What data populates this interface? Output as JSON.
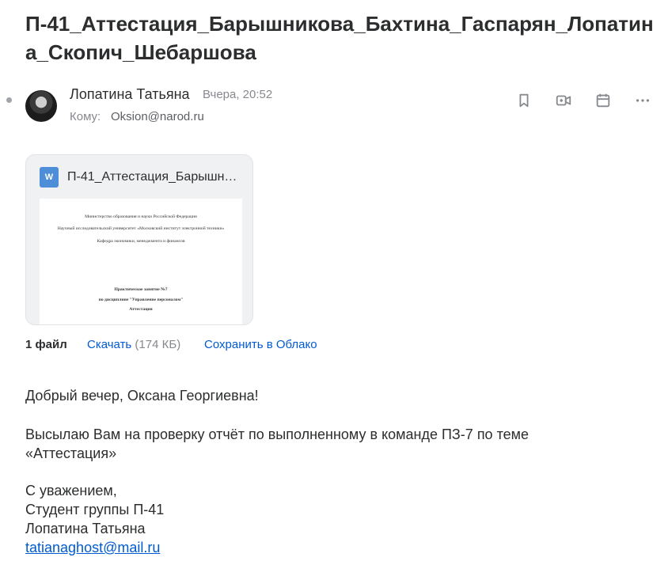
{
  "message": {
    "subject": "П-41_Аттестация_Барышникова_Бахтина_Гаспарян_Лопатина_Скопич_Шебаршова",
    "sender": {
      "name": "Лопатина Татьяна",
      "time": "Вчера, 20:52"
    },
    "recipient": {
      "label": "Кому:",
      "address": "Oksion@narod.ru"
    }
  },
  "header_actions": [
    "bookmark-icon",
    "video-call-icon",
    "calendar-icon",
    "more-icon"
  ],
  "attachment": {
    "file_name": "П-41_Аттестация_Барышн…",
    "icon_letter": "W",
    "preview_lines": [
      "Министерство образования и науки Российской Федерации",
      "Научный исследовательский университет «Московский институт электронной техники»",
      "Кафедра экономики, менеджмента и финансов",
      "Практическое занятие №7",
      "по дисциплине \"Управление персоналом\"",
      "Аттестация"
    ]
  },
  "files": {
    "count": "1 файл",
    "download_label": "Скачать",
    "size": "(174 КБ)",
    "cloud_label": "Сохранить в Облако"
  },
  "body": {
    "greeting": "Добрый вечер, Оксана Георгиевна!",
    "para_line1": "Высылаю Вам на проверку отчёт по выполненному в команде ПЗ-7 по теме",
    "para_line2": "«Аттестация»",
    "signoff": "С уважением,",
    "group": "Студент группы П-41",
    "signature_name": "Лопатина Татьяна",
    "email": "tatianaghost@mail.ru"
  },
  "colors": {
    "link": "#005bd1",
    "muted": "#87898f",
    "text": "#2c2d2e",
    "word_blue": "#4e8ed9"
  }
}
